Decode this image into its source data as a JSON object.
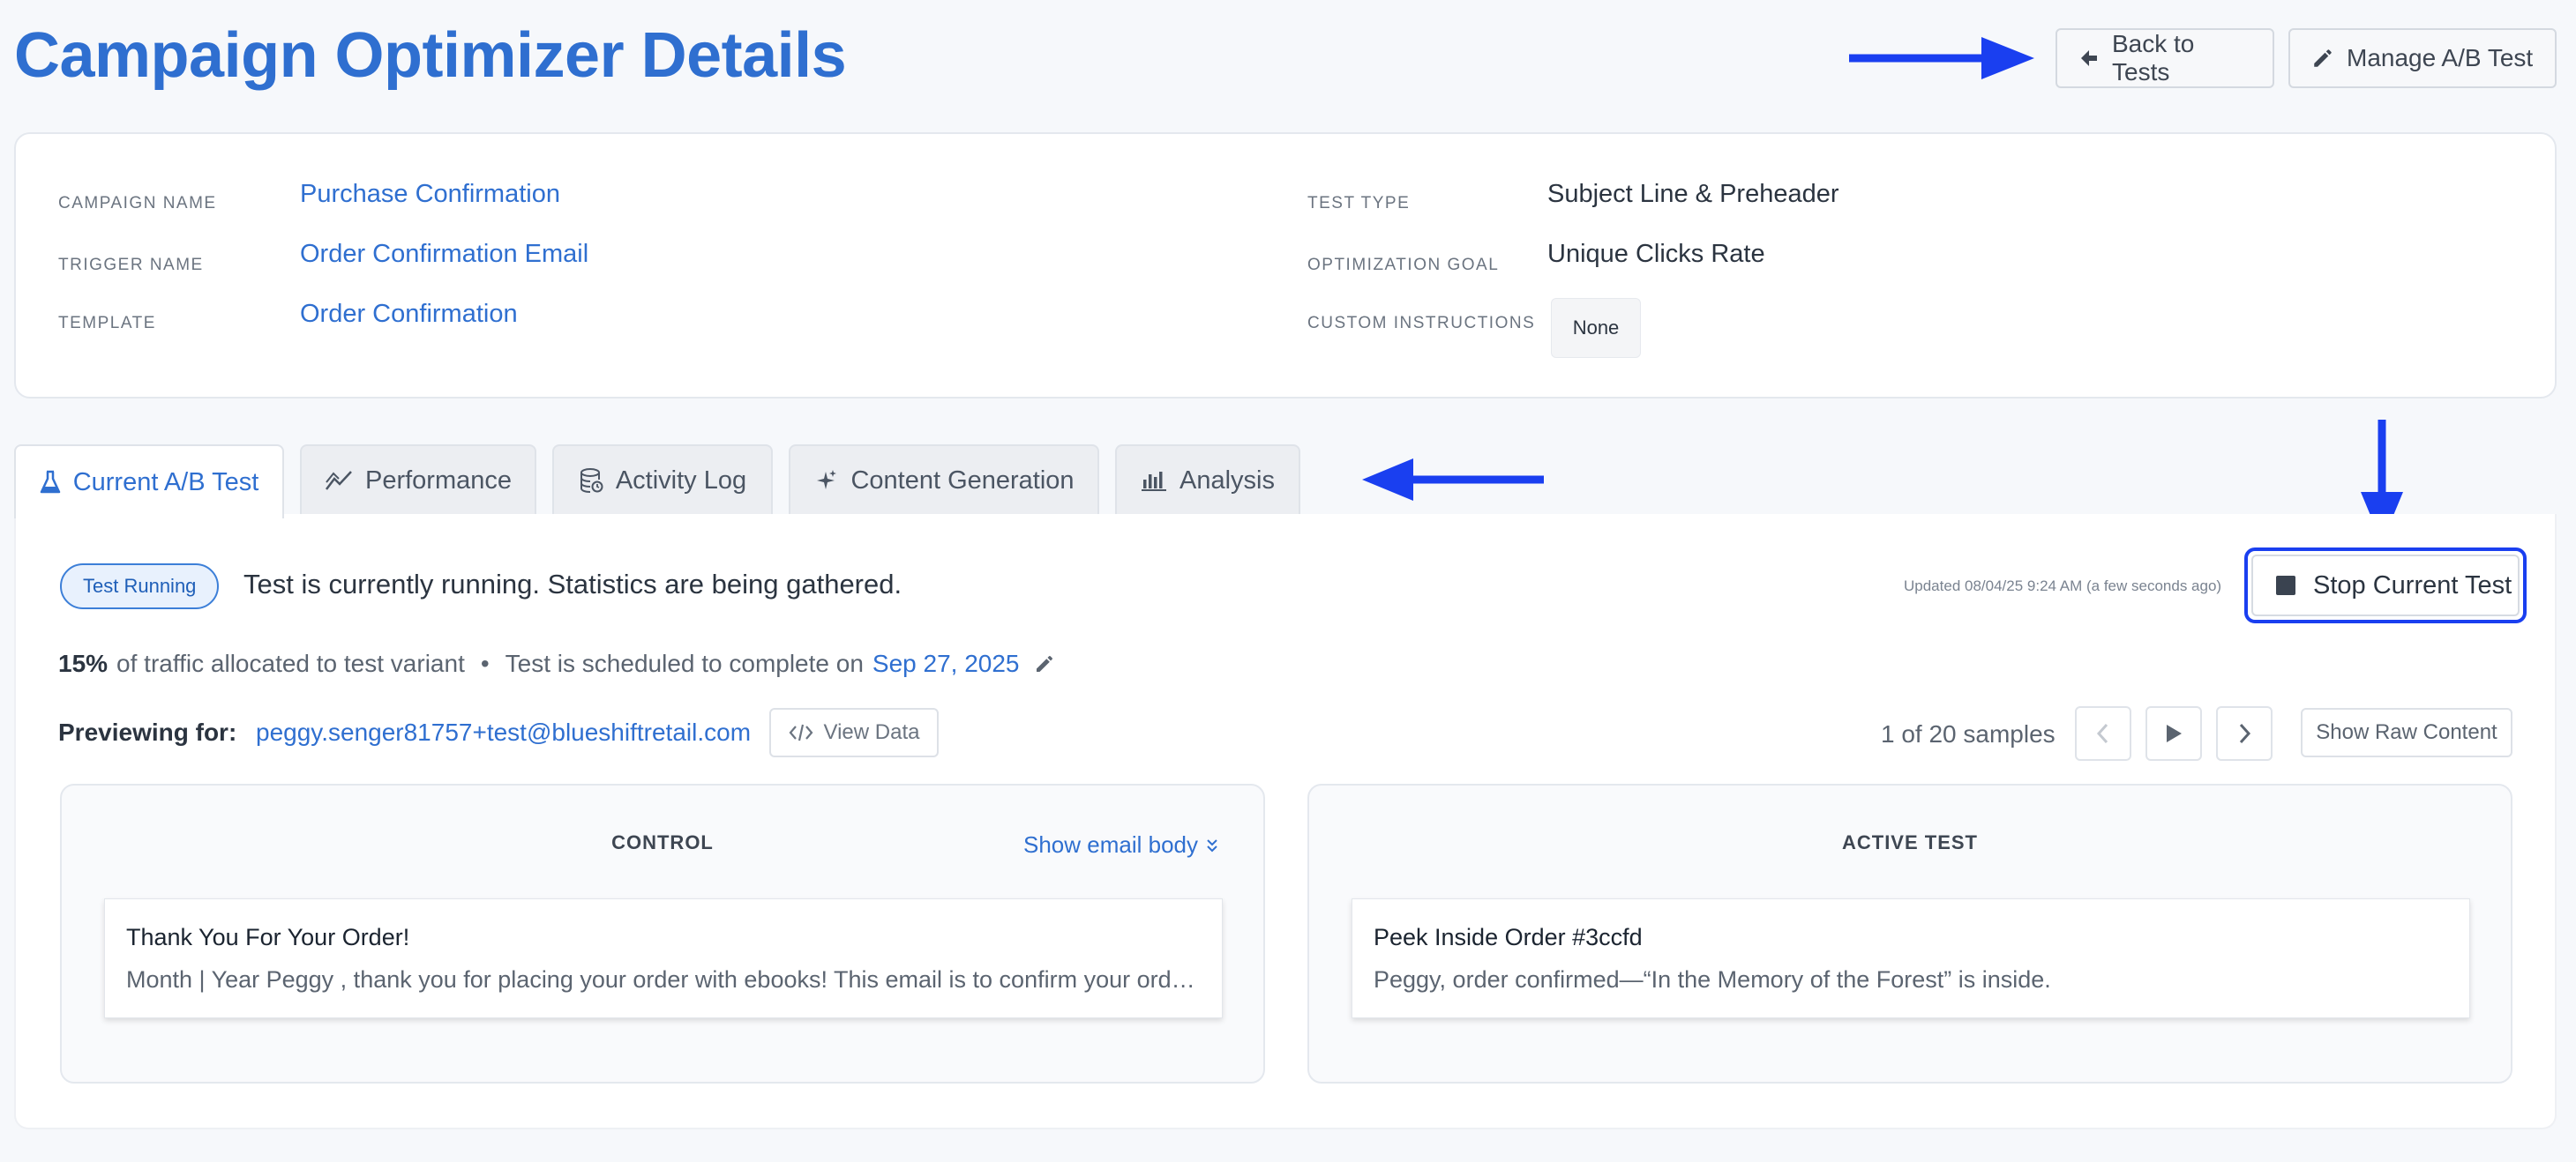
{
  "header": {
    "title": "Campaign Optimizer Details",
    "back_label": "Back to Tests",
    "manage_label": "Manage A/B Test"
  },
  "info": {
    "campaign_name_label": "CAMPAIGN NAME",
    "campaign_name": "Purchase Confirmation",
    "trigger_name_label": "TRIGGER NAME",
    "trigger_name": "Order Confirmation Email",
    "template_label": "TEMPLATE",
    "template": "Order Confirmation",
    "test_type_label": "TEST TYPE",
    "test_type": "Subject Line & Preheader",
    "optimization_goal_label": "OPTIMIZATION GOAL",
    "optimization_goal": "Unique Clicks Rate",
    "custom_instructions_label": "CUSTOM INSTRUCTIONS",
    "custom_instructions": "None"
  },
  "tabs": [
    {
      "label": "Current A/B Test",
      "icon": "flask-icon",
      "active": true
    },
    {
      "label": "Performance",
      "icon": "trend-line-icon",
      "active": false
    },
    {
      "label": "Activity Log",
      "icon": "database-icon",
      "active": false
    },
    {
      "label": "Content Generation",
      "icon": "sparkle-icon",
      "active": false
    },
    {
      "label": "Analysis",
      "icon": "bar-chart-icon",
      "active": false
    }
  ],
  "status": {
    "badge": "Test Running",
    "message": "Test is currently running. Statistics are being gathered.",
    "updated": "Updated 08/04/25 9:24 AM (a few seconds ago)",
    "stop_label": "Stop Current Test"
  },
  "traffic": {
    "percent": "15%",
    "text": "of traffic allocated to test variant",
    "separator": "•",
    "schedule_text": "Test is scheduled to complete on",
    "date": "Sep 27, 2025"
  },
  "preview": {
    "label": "Previewing for:",
    "email": "peggy.senger81757+test@blueshiftretail.com",
    "view_data_label": "View Data",
    "samples_text": "1 of 20 samples",
    "raw_label": "Show Raw Content"
  },
  "control": {
    "title": "CONTROL",
    "show_body_label": "Show email body",
    "subject": "Thank You For Your Order!",
    "preheader": "Month | Year Peggy , thank you for placing your order with ebooks! This email is to confirm your order details and provide you with a summary."
  },
  "active_test": {
    "title": "ACTIVE TEST",
    "subject": "Peek Inside Order #3ccfd",
    "preheader": "Peggy, order confirmed—“In the Memory of the Forest” is inside."
  },
  "colors": {
    "accent": "#2f6fd0",
    "annotation_arrow": "#1a3ff0",
    "background": "#f6f8fb"
  }
}
